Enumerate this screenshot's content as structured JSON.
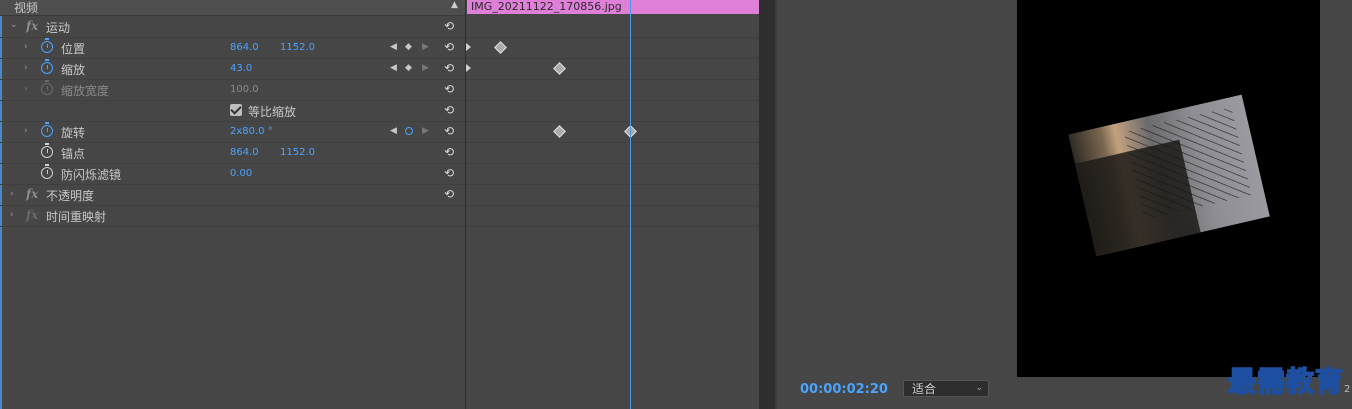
{
  "effect_controls": {
    "section_title": "视频",
    "collapse_glyph": "▲",
    "effects": {
      "motion": {
        "label": "运动",
        "fx": "fx"
      },
      "opacity": {
        "label": "不透明度",
        "fx": "fx"
      },
      "time_remap": {
        "label": "时间重映射",
        "fx": "fx"
      }
    },
    "properties": {
      "position": {
        "label": "位置",
        "value_x": "864.0",
        "value_y": "1152.0"
      },
      "scale": {
        "label": "缩放",
        "value": "43.0"
      },
      "scale_width": {
        "label": "缩放宽度",
        "value": "100.0"
      },
      "uniform_scale": {
        "label": "等比缩放",
        "checked": true
      },
      "rotation": {
        "label": "旋转",
        "value": "2x80.0 °"
      },
      "anchor_point": {
        "label": "锚点",
        "value_x": "864.0",
        "value_y": "1152.0"
      },
      "anti_flicker": {
        "label": "防闪烁滤镜",
        "value": "0.00"
      }
    },
    "icons": {
      "reset": "reset-icon",
      "stopwatch": "stopwatch-icon",
      "chevron": "chevron-right-icon"
    },
    "glyphs": {
      "chevron_right": "›",
      "chevron_down": "⌄",
      "prev": "◀",
      "add": "◆",
      "next": "▶",
      "reset": "⟲"
    }
  },
  "timeline": {
    "clip_name": "IMG_20211122_170856.jpg",
    "clip_color": "#e07fd8"
  },
  "program_monitor": {
    "timecode": "00:00:02:20",
    "fit_value": "适合",
    "caret": "⌄",
    "edge_number": "2"
  },
  "watermark": "最需教育"
}
